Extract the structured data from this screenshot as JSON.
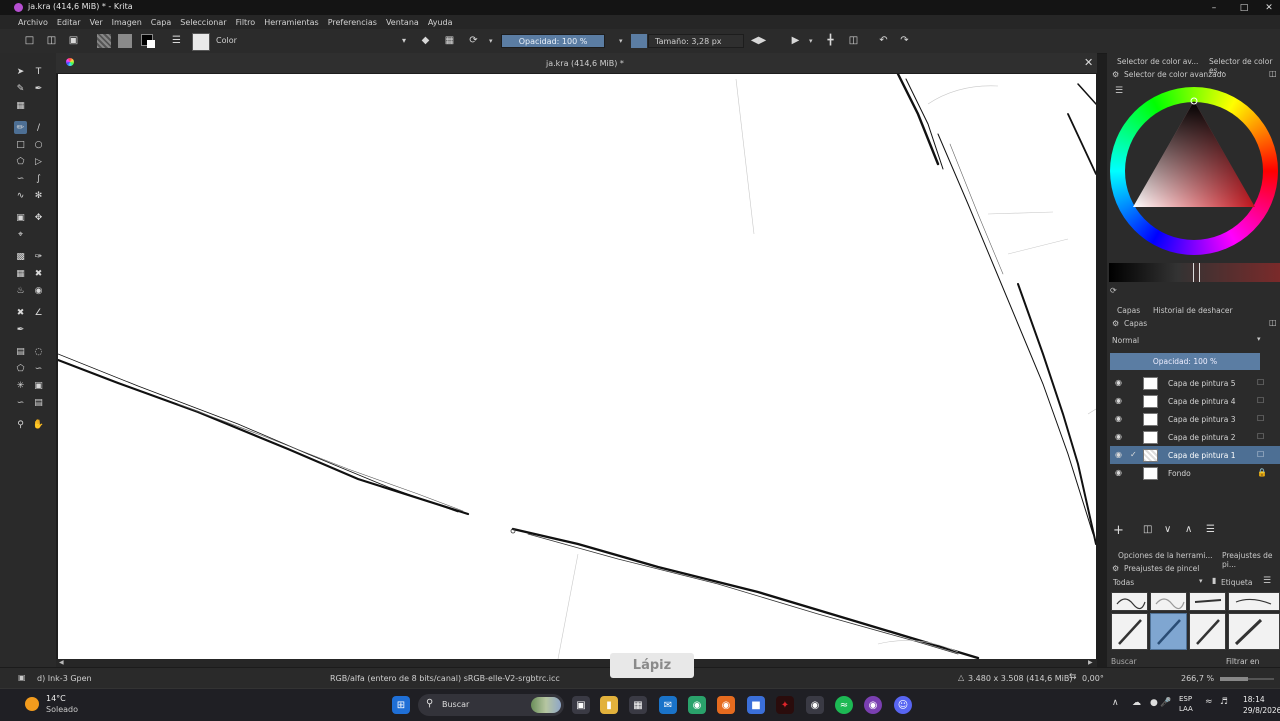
{
  "window": {
    "title": "ja.kra (414,6 MiB) * - Krita"
  },
  "menu": [
    "Archivo",
    "Editar",
    "Ver",
    "Imagen",
    "Capa",
    "Seleccionar",
    "Filtro",
    "Herramientas",
    "Preferencias",
    "Ventana",
    "Ayuda"
  ],
  "toolbar": {
    "blend_mode": "Color",
    "opacity": "Opacidad: 100 %",
    "size": "Tamaño: 3,28 px"
  },
  "canvas": {
    "tab_title": "ja.kra (414,6 MiB) *"
  },
  "dock": {
    "color_tabs": [
      "Selector de color av...",
      "Selector de color es..."
    ],
    "color_panel_title": "Selector de color avanzado",
    "layer_tabs": [
      "Capas",
      "Historial de deshacer"
    ],
    "layers_title": "Capas",
    "blend_mode": "Normal",
    "layer_opacity": "Opacidad: 100 %",
    "layers": [
      {
        "name": "Capa de pintura 5",
        "selected": false
      },
      {
        "name": "Capa de pintura 4",
        "selected": false
      },
      {
        "name": "Capa de pintura 3",
        "selected": false
      },
      {
        "name": "Capa de pintura 2",
        "selected": false
      },
      {
        "name": "Capa de pintura 1",
        "selected": true
      },
      {
        "name": "Fondo",
        "selected": false
      }
    ],
    "bottom_tabs": [
      "Opciones de la herrami...",
      "Preajustes de pi..."
    ],
    "presets_title": "Preajustes de pincel",
    "presets_filter": "Todas",
    "tag_label": "Etiqueta",
    "search_placeholder": "Buscar",
    "filter_tag": "Filtrar en etique"
  },
  "status": {
    "brush": "d) Ink-3 Gpen",
    "color_space": "RGB/alfa (entero de 8 bits/canal)  sRGB-elle-V2-srgbtrc.icc",
    "dimensions": "3.480 x 3.508 (414,6 MiB)",
    "rotation": "0,00°",
    "zoom": "266,7 %"
  },
  "osd": "Lápiz",
  "taskbar": {
    "weather_temp": "14°C",
    "weather_desc": "Soleado",
    "search_label": "Buscar",
    "lang_top": "ESP",
    "lang_bottom": "LAA",
    "time": "18:14",
    "date": "29/8/2026"
  }
}
